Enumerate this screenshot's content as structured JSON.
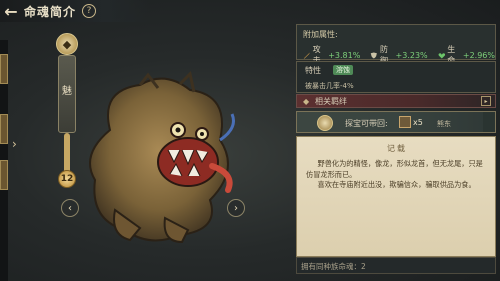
{
  "header": {
    "title": "命魂简介",
    "help": "?",
    "back_icon": "back-arrow-icon"
  },
  "card": {
    "seal_glyph": "◆",
    "name": "魅",
    "level": "12"
  },
  "nav": {
    "prev": "‹",
    "next": "›",
    "left_arrow": "›"
  },
  "attributes": {
    "title": "附加属性:",
    "items": [
      {
        "label": "攻击",
        "value": "+3.81%",
        "icon": "sword-icon",
        "color": "#d8a24a"
      },
      {
        "label": "防御",
        "value": "+3.23%",
        "icon": "shield-icon",
        "color": "#c9c2a6"
      },
      {
        "label": "生命",
        "value": "+2.96%",
        "icon": "heart-icon",
        "color": "#6cc46a"
      }
    ]
  },
  "trait": {
    "label": "特性",
    "badge": "溶蚀",
    "desc": "被暴击几率-4%"
  },
  "relation": {
    "label": "相关羁绊",
    "arrow": "▸"
  },
  "treasure": {
    "label": "探宝可带回:",
    "count": "x5",
    "target": "熊东"
  },
  "record": {
    "title": "记载",
    "paragraphs": [
      "野兽化为的精怪，像龙，形似龙首，但无龙尾，只是仿冒龙形而已。",
      "喜欢在寺庙附近出没，欺骗信众，骗取供品为食。"
    ]
  },
  "footer": {
    "text": "拥有同种族命魂：2"
  }
}
